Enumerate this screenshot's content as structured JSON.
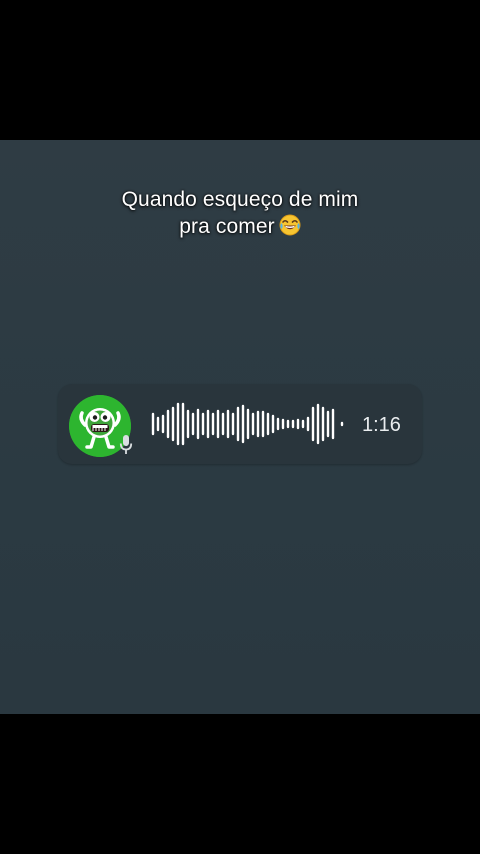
{
  "caption": {
    "line1": "Quando esqueço de mim",
    "line2": "pra comer",
    "emoji": "😂"
  },
  "voice_message": {
    "duration": "1:16",
    "avatar_icon": "green-cartoon-character-avatar",
    "mic_icon": "microphone-icon",
    "waveform_icon": "audio-waveform"
  },
  "colors": {
    "background": "#2c3a42",
    "bubble": "#29353c",
    "avatar_green": "#2db52f",
    "text": "#ffffff"
  }
}
